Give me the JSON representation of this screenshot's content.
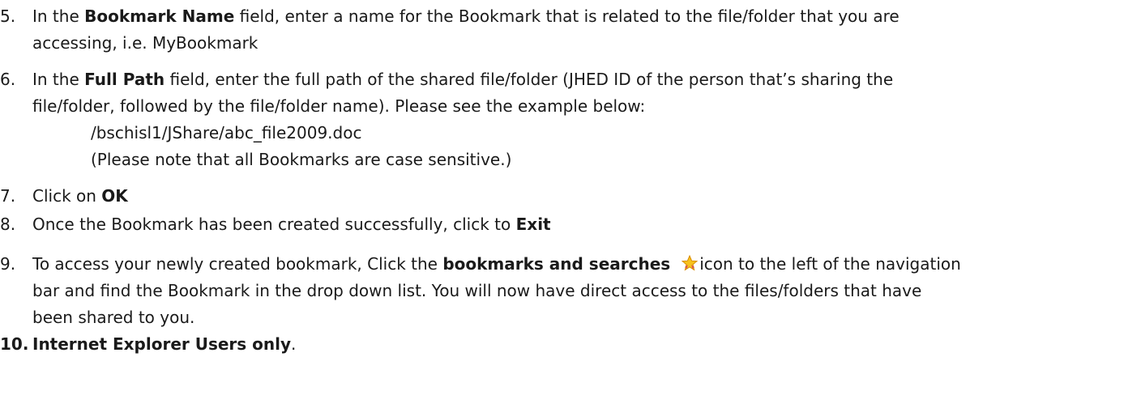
{
  "steps": [
    {
      "number": "5.",
      "prefix": "In the ",
      "bold": "Bookmark Name",
      "suffix": " field, enter a name for the Bookmark that is related to the file/folder that you are",
      "cont": "accessing, i.e. MyBookmark"
    },
    {
      "number": "6.",
      "prefix": "In the ",
      "bold": "Full Path",
      "suffix": " field, enter the full path of the shared file/folder (JHED ID of the person that’s sharing the",
      "cont": "file/folder, followed by the file/folder name).  Please see  the example below:",
      "example_path": "/bschisl1/JShare/abc_file2009.doc",
      "note": "(Please note that all Bookmarks are case sensitive.)"
    },
    {
      "number": "7.",
      "prefix": "Click on ",
      "bold": "OK"
    },
    {
      "number": "8.",
      "prefix": "Once the Bookmark has been created successfully, click to ",
      "bold": "Exit"
    },
    {
      "number": "9.",
      "prefix": "To access your newly created bookmark, Click the ",
      "bold": "bookmarks and searches",
      "icon": "bookmark-star-icon",
      "suffix": "icon to the left of the navigation",
      "cont1": "bar and find the Bookmark in the drop down list.  You will now have direct access to the files/folders that have",
      "cont2": "been shared to you."
    },
    {
      "number": "10.",
      "bold": "Internet Explorer Users only",
      "suffix": "."
    }
  ]
}
